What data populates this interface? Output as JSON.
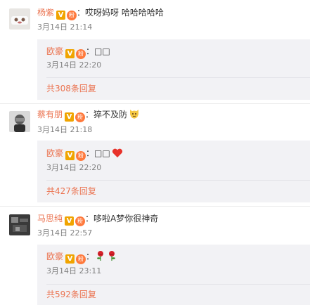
{
  "comments": [
    {
      "name": "杨紫",
      "vip_badge": "V",
      "fan_badge": "粉",
      "text": "：哎呀妈呀 哈哈哈哈哈",
      "time": "3月14日 21:14",
      "reply": {
        "name": "欧豪",
        "vip_badge": "V",
        "fan_badge": "粉",
        "text": "：□□",
        "time": "3月14日 22:20"
      },
      "more": "共308条回复"
    },
    {
      "name": "蔡有朋",
      "vip_badge": "V",
      "fan_badge": "粉",
      "text": "：猝不及防",
      "emoji": "cat-face-emoji",
      "time": "3月14日 21:18",
      "reply": {
        "name": "欧豪",
        "vip_badge": "V",
        "fan_badge": "粉",
        "text": "：□□",
        "emoji": "red-heart-emoji",
        "time": "3月14日 22:20"
      },
      "more": "共427条回复"
    },
    {
      "name": "马思纯",
      "vip_badge": "V",
      "fan_badge": "粉",
      "text": "：哆啦A梦你很神奇",
      "time": "3月14日 22:57",
      "reply": {
        "name": "欧豪",
        "vip_badge": "V",
        "fan_badge": "粉",
        "text": "：",
        "emoji": "rose-emoji",
        "time": "3月14日 23:11"
      },
      "more": "共592条回复"
    }
  ],
  "colors": {
    "name": "#eb7350",
    "time": "#808080",
    "reply_bg": "#f2f2f5"
  }
}
